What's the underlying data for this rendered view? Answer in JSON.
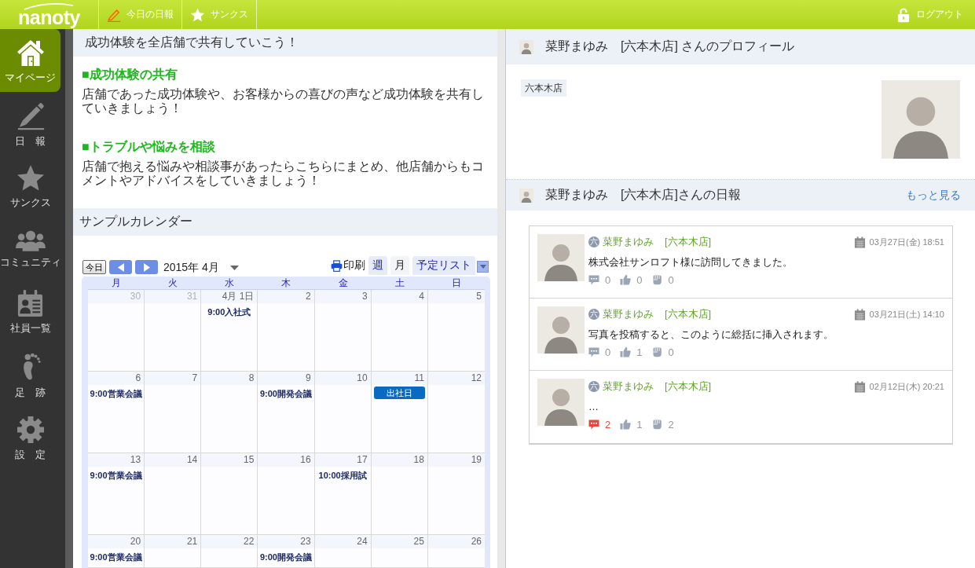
{
  "topbar": {
    "logo": "nanoty",
    "nav": [
      {
        "label": "今日の日報"
      },
      {
        "label": "サンクス"
      }
    ],
    "logout": "ログアウト"
  },
  "sidebar": {
    "items": [
      {
        "label": "マイページ",
        "selected": true
      },
      {
        "label": "日　報",
        "selected": false
      },
      {
        "label": "サンクス",
        "selected": false
      },
      {
        "label": "コミュニティ",
        "selected": false
      },
      {
        "label": "社員一覧",
        "selected": false
      },
      {
        "label": "足　跡",
        "selected": false
      },
      {
        "label": "設　定",
        "selected": false
      }
    ]
  },
  "info_panel": {
    "title": "成功体験を全店舗で共有していこう！",
    "sections": [
      {
        "heading": "■成功体験の共有",
        "body": "店舗であった成功体験や、お客様からの喜びの声など成功体験を共有していきましょう！"
      },
      {
        "heading": "■トラブルや悩みを相談",
        "body": "店舗で抱える悩みや相談事があったらこちらにまとめ、他店舗からもコメントやアドバイスをしていきましょう！"
      }
    ]
  },
  "calendar": {
    "title": "サンプルカレンダー",
    "today_button": "今日",
    "month_label": "2015年 4月",
    "print": "印刷",
    "views": [
      {
        "label": "週",
        "selected": false
      },
      {
        "label": "月",
        "selected": true
      },
      {
        "label": "予定リスト",
        "selected": false
      }
    ],
    "weekdays": [
      "月",
      "火",
      "水",
      "木",
      "金",
      "土",
      "日"
    ],
    "weeks": [
      {
        "days": [
          {
            "date": "30",
            "other_month": true
          },
          {
            "date": "31",
            "other_month": true
          },
          {
            "date": "4月 1日",
            "other_month": false,
            "events": [
              {
                "kind": "timed",
                "text": "9:00入社式"
              }
            ]
          },
          {
            "date": "2",
            "other_month": false
          },
          {
            "date": "3",
            "other_month": false
          },
          {
            "date": "4",
            "other_month": false
          },
          {
            "date": "5",
            "other_month": false
          }
        ]
      },
      {
        "days": [
          {
            "date": "6",
            "other_month": false,
            "events": [
              {
                "kind": "timed",
                "text": "9:00営業会議"
              }
            ]
          },
          {
            "date": "7",
            "other_month": false
          },
          {
            "date": "8",
            "other_month": false
          },
          {
            "date": "9",
            "other_month": false,
            "events": [
              {
                "kind": "timed",
                "text": "9:00開発会議"
              }
            ]
          },
          {
            "date": "10",
            "other_month": false
          },
          {
            "date": "11",
            "other_month": false,
            "events": [
              {
                "kind": "allday",
                "text": "出社日"
              }
            ]
          },
          {
            "date": "12",
            "other_month": false
          }
        ]
      },
      {
        "days": [
          {
            "date": "13",
            "other_month": false,
            "events": [
              {
                "kind": "timed",
                "text": "9:00営業会議"
              }
            ]
          },
          {
            "date": "14",
            "other_month": false
          },
          {
            "date": "15",
            "other_month": false
          },
          {
            "date": "16",
            "other_month": false
          },
          {
            "date": "17",
            "other_month": false,
            "events": [
              {
                "kind": "timed",
                "text": "10:00採用試"
              }
            ]
          },
          {
            "date": "18",
            "other_month": false
          },
          {
            "date": "19",
            "other_month": false
          }
        ]
      },
      {
        "days": [
          {
            "date": "20",
            "other_month": false,
            "events": [
              {
                "kind": "timed",
                "text": "9:00営業会議"
              }
            ]
          },
          {
            "date": "21",
            "other_month": false
          },
          {
            "date": "22",
            "other_month": false
          },
          {
            "date": "23",
            "other_month": false,
            "events": [
              {
                "kind": "timed",
                "text": "9:00開発会議"
              }
            ]
          },
          {
            "date": "24",
            "other_month": false
          },
          {
            "date": "25",
            "other_month": false
          },
          {
            "date": "26",
            "other_month": false
          }
        ]
      }
    ]
  },
  "profile": {
    "title": "菜野まゆみ　[六本木店] さんのプロフィール",
    "tags": [
      "六本木店"
    ]
  },
  "diary": {
    "title": "菜野まゆみ　[六本木店]さんの日報",
    "more_link": "もっと見る",
    "entries": [
      {
        "store_badge": "六",
        "author": "菜野まゆみ",
        "store": "[六本木店]",
        "date": "03月27日(金) 18:51",
        "text": "株式会社サンロフト様に訪問してきました。",
        "comments": "0",
        "comment_alert": false,
        "likes": "0",
        "claps": "0"
      },
      {
        "store_badge": "六",
        "author": "菜野まゆみ",
        "store": "[六本木店]",
        "date": "03月21日(土) 14:10",
        "text": "写真を投稿すると、このように総括に挿入されます。",
        "comments": "0",
        "comment_alert": false,
        "likes": "1",
        "claps": "0"
      },
      {
        "store_badge": "六",
        "author": "菜野まゆみ",
        "store": "[六本木店]",
        "date": "02月12日(木) 20:21",
        "text": "…",
        "comments": "2",
        "comment_alert": true,
        "likes": "1",
        "claps": "2"
      }
    ]
  }
}
